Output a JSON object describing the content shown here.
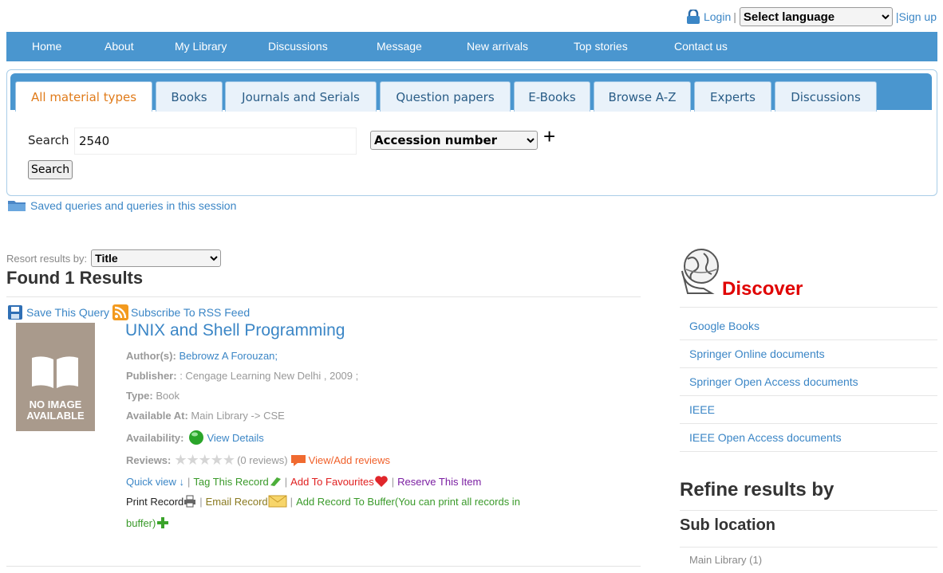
{
  "topbar": {
    "login": "Login",
    "separator": "|",
    "language_selected": "Select language",
    "signup": "|Sign up",
    "lock_icon": "lock-icon"
  },
  "nav": {
    "items": [
      "Home",
      "About",
      "My Library",
      "Discussions",
      "Message",
      "New arrivals",
      "Top stories",
      "Contact us"
    ]
  },
  "tabs": {
    "items": [
      "All material types",
      "Books",
      "Journals and Serials",
      "Question papers",
      "E-Books",
      "Browse A-Z",
      "Experts",
      "Discussions"
    ],
    "active": "All material types"
  },
  "search": {
    "label": "Search",
    "value": "2540",
    "field_selected": "Accession number",
    "plus": "+",
    "button": "Search"
  },
  "saved_queries": "Saved queries and queries in this session",
  "results": {
    "resort_label": "Resort results by:",
    "resort_selected": "Title",
    "found": "Found 1 Results",
    "save_query": "Save This Query",
    "subscribe": "Subscribe To RSS Feed"
  },
  "record": {
    "thumb_text_1": "NO IMAGE",
    "thumb_text_2": "AVAILABLE",
    "title": "UNIX and Shell Programming",
    "author_label": "Author(s):",
    "author": "Bebrowz A Forouzan;",
    "publisher_label": "Publisher:",
    "publisher": ": Cengage Learning New Delhi , 2009 ;",
    "type_label": "Type:",
    "type": "Book",
    "available_label": "Available At:",
    "available": "Main Library -> CSE",
    "availability_label": "Availability:",
    "view_details": "View Details",
    "reviews_label": "Reviews:",
    "rating": 0,
    "reviews_count": "(0 reviews)",
    "view_add_reviews": "View/Add reviews",
    "quick_view": "Quick view ↓",
    "sep": "|",
    "tag": "Tag This Record",
    "favourites": "Add To Favourites",
    "reserve": "Reserve This Item",
    "print": "Print Record",
    "email": "Email Record",
    "buffer_1": "Add Record To Buffer(You can print all records in",
    "buffer_2": "buffer)"
  },
  "sidebar": {
    "discover": "Discover",
    "links": [
      "Google Books",
      "Springer Online documents",
      "Springer Open Access documents",
      "IEEE",
      "IEEE Open Access documents"
    ],
    "refine": "Refine results by",
    "sub_location": "Sub location",
    "main_library": "Main Library (1)"
  },
  "colors": {
    "nav_bg": "#4a96cf",
    "link": "#3b86c6",
    "active_tab_text": "#e07b1a",
    "discover": "#e00000"
  }
}
